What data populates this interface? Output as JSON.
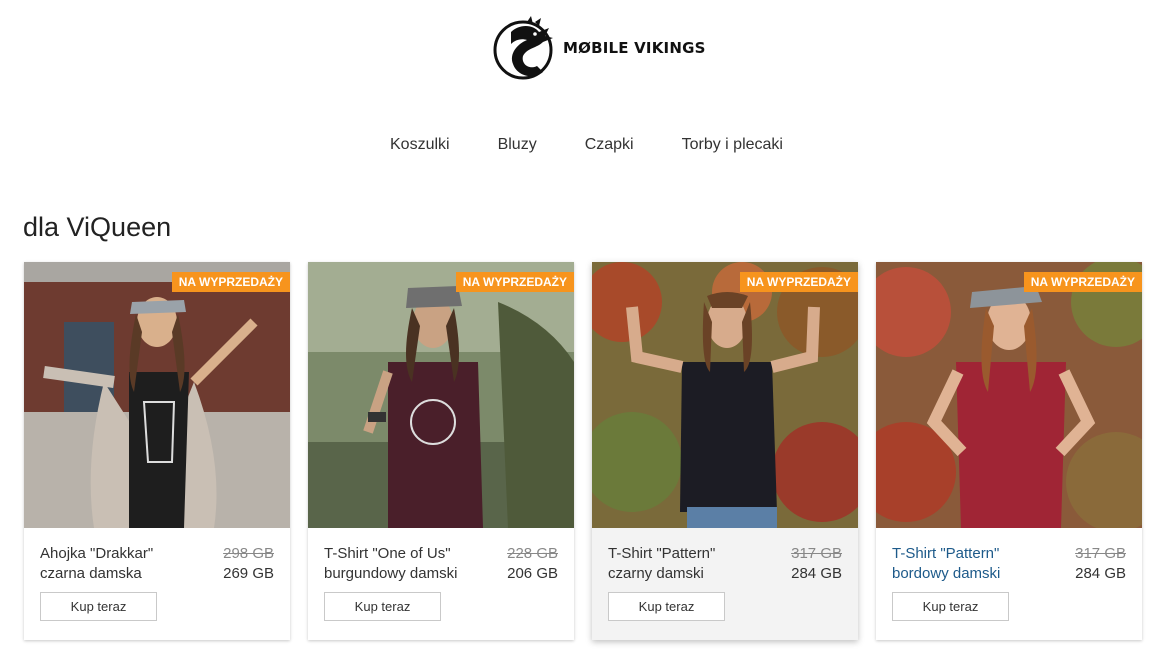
{
  "brand": {
    "name": "MØBILE VIKINGS"
  },
  "nav": [
    "Koszulki",
    "Bluzy",
    "Czapki",
    "Torby i plecaki"
  ],
  "section_title": "dla ViQueen",
  "products": [
    {
      "badge": "NA WYPRZEDAŻY",
      "name_line1": "Ahojka \"Drakkar\"",
      "name_line2": "czarna damska",
      "old_price": "298 GB",
      "price": "269 GB",
      "buy_label": "Kup teraz"
    },
    {
      "badge": "NA WYPRZEDAŻY",
      "name_line1": "T-Shirt \"One of Us\"",
      "name_line2": "burgundowy damski",
      "old_price": "228 GB",
      "price": "206 GB",
      "buy_label": "Kup teraz"
    },
    {
      "badge": "NA WYPRZEDAŻY",
      "name_line1": "T-Shirt \"Pattern\"",
      "name_line2": "czarny damski",
      "old_price": "317 GB",
      "price": "284 GB",
      "buy_label": "Kup teraz"
    },
    {
      "badge": "NA WYPRZEDAŻY",
      "name_line1": "T-Shirt \"Pattern\"",
      "name_line2": "bordowy damski",
      "old_price": "317 GB",
      "price": "284 GB",
      "buy_label": "Kup teraz"
    }
  ],
  "colors": {
    "badge": "#f7941d",
    "link": "#1d5a8a"
  }
}
